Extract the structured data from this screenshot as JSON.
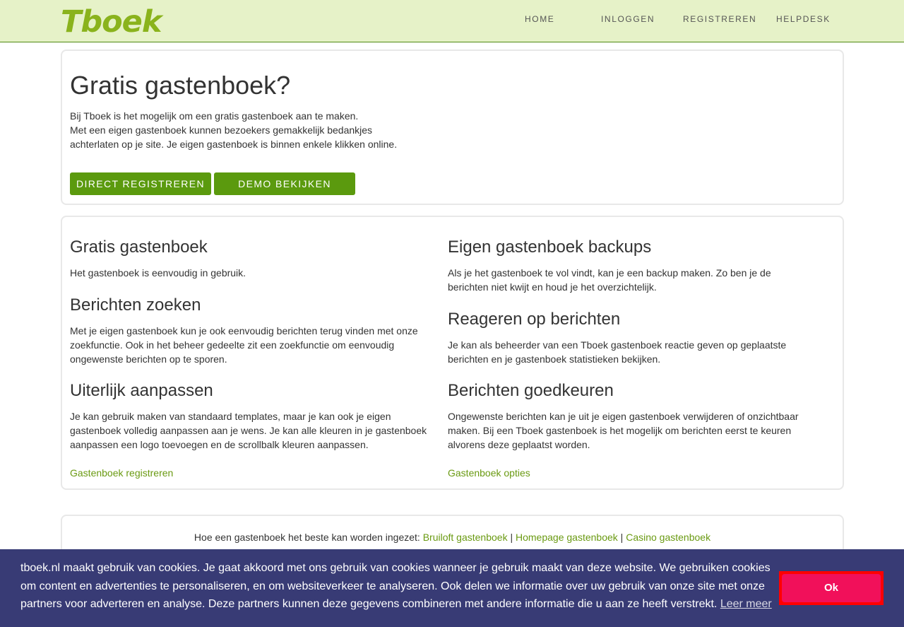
{
  "header": {
    "logo": "Tboek",
    "nav": [
      {
        "label": "HOME"
      },
      {
        "label": "INLOGGEN"
      },
      {
        "label": "REGISTREREN"
      },
      {
        "label": "HELPDESK"
      }
    ]
  },
  "hero": {
    "title": "Gratis gastenboek?",
    "intro_lines": [
      "Bij Tboek is het mogelijk om een gratis gastenboek aan te maken.",
      "Met een eigen gastenboek kunnen bezoekers gemakkelijk bedankjes achterlaten op je site. Je eigen gastenboek is binnen enkele klikken online."
    ],
    "buttons": {
      "register": "DIRECT REGISTREREN",
      "demo": "DEMO BEKIJKEN"
    }
  },
  "features": {
    "left": [
      {
        "title": "Gratis gastenboek",
        "text": "Het gastenboek is eenvoudig in gebruik."
      },
      {
        "title": "Berichten zoeken",
        "text": "Met je eigen gastenboek kun je ook eenvoudig berichten terug vinden met onze zoekfunctie. Ook in het beheer gedeelte zit een zoekfunctie om eenvoudig ongewenste berichten op te sporen."
      },
      {
        "title": "Uiterlijk aanpassen",
        "text": "Je kan gebruik maken van standaard templates, maar je kan ook je eigen gastenboek volledig aanpassen aan je wens. Je kan alle kleuren in je gastenboek aanpassen een logo toevoegen en de scrollbalk kleuren aanpassen."
      }
    ],
    "right": [
      {
        "title": "Eigen gastenboek backups",
        "text": "Als je het gastenboek te vol vindt, kan je een backup maken. Zo ben je de berichten niet kwijt en houd je het overzichtelijk."
      },
      {
        "title": "Reageren op berichten",
        "text": "Je kan als beheerder van een Tboek gastenboek reactie geven op geplaatste berichten en je gastenboek statistieken bekijken."
      },
      {
        "title": "Berichten goedkeuren",
        "text": "Ongewenste berichten kan je uit je eigen gastenboek verwijderen of onzichtbaar maken. Bij een Tboek gastenboek is het mogelijk om berichten eerst te keuren alvorens deze geplaatst worden."
      }
    ],
    "left_link": "Gastenboek registreren",
    "right_link": "Gastenboek opties"
  },
  "footer": {
    "prefix": "Hoe een gastenboek het beste kan worden ingezet: ",
    "links": [
      "Bruiloft gastenboek",
      "Homepage gastenboek",
      "Casino gastenboek"
    ],
    "separator": " | "
  },
  "cookie": {
    "message": "tboek.nl maakt gebruik van cookies. Je gaat akkoord met ons gebruik van cookies wanneer je gebruik maakt van deze website. We gebruiken cookies om content en advertenties te personaliseren, en om websiteverkeer te analyseren. Ook delen we informatie over uw gebruik van onze site met onze partners voor adverteren en analyse. Deze partners kunnen deze gegevens combineren met andere informatie die u aan ze heeft verstrekt.",
    "learn_more": "Leer meer",
    "ok": "Ok"
  },
  "colors": {
    "header_bg": "#e6f2c8",
    "accent_green": "#5b9a0e",
    "link_green": "#6a9a12",
    "cookie_bg": "#383b75",
    "cookie_button": "#f1105a"
  }
}
